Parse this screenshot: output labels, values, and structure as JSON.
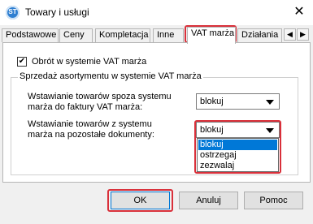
{
  "window": {
    "title": "Towary i usługi",
    "app_icon_text": "ST"
  },
  "tabs": [
    {
      "label": "Podstawowe"
    },
    {
      "label": "Ceny"
    },
    {
      "label": "Kompletacja"
    },
    {
      "label": "Inne"
    },
    {
      "label": "VAT marża",
      "active": true
    },
    {
      "label": "Działania"
    }
  ],
  "checkbox": {
    "label": "Obrót w systemie VAT marża",
    "checked": true
  },
  "group": {
    "title": "Sprzedaż asortymentu w systemie VAT marża",
    "field1": {
      "label_line1": "Wstawianie towarów spoza systemu",
      "label_line2": "marża do faktury VAT marża:",
      "value": "blokuj"
    },
    "field2": {
      "label_line1": "Wstawianie towarów z systemu",
      "label_line2": "marża na pozostałe dokumenty:",
      "value": "blokuj",
      "options": [
        "blokuj",
        "ostrzegaj",
        "zezwalaj"
      ],
      "selected_option": "blokuj"
    }
  },
  "buttons": {
    "ok": "OK",
    "cancel": "Anuluj",
    "help": "Pomoc"
  },
  "colors": {
    "highlight": "#d9303a",
    "selection": "#0078d7"
  }
}
